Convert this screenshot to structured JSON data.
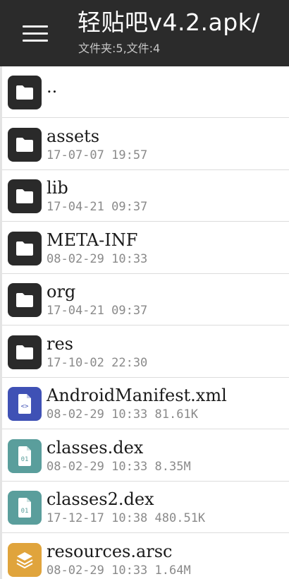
{
  "appbar": {
    "title": "轻贴吧v4.2.apk/",
    "subtitle": "文件夹:5,文件:4",
    "menu_icon": "hamburger-menu-icon",
    "color": "#2b2b2b"
  },
  "colors": {
    "folder": "#2a2a2a",
    "xml": "#3f51b5",
    "dex": "#5a9e9c",
    "arsc": "#e0a43c"
  },
  "files": [
    {
      "name": "..",
      "meta": "",
      "kind": "folder",
      "icon": "folder-icon"
    },
    {
      "name": "assets",
      "meta": "17-07-07 19:57",
      "kind": "folder",
      "icon": "folder-icon"
    },
    {
      "name": "lib",
      "meta": "17-04-21 09:37",
      "kind": "folder",
      "icon": "folder-icon"
    },
    {
      "name": "META-INF",
      "meta": "08-02-29 10:33",
      "kind": "folder",
      "icon": "folder-icon"
    },
    {
      "name": "org",
      "meta": "17-04-21 09:37",
      "kind": "folder",
      "icon": "folder-icon"
    },
    {
      "name": "res",
      "meta": "17-10-02 22:30",
      "kind": "folder",
      "icon": "folder-icon"
    },
    {
      "name": "AndroidManifest.xml",
      "meta": "08-02-29 10:33  81.61K",
      "kind": "xml",
      "icon": "code-file-icon"
    },
    {
      "name": "classes.dex",
      "meta": "08-02-29 10:33  8.35M",
      "kind": "dex",
      "icon": "binary-file-icon"
    },
    {
      "name": "classes2.dex",
      "meta": "17-12-17 10:38  480.51K",
      "kind": "dex",
      "icon": "binary-file-icon"
    },
    {
      "name": "resources.arsc",
      "meta": "08-02-29 10:33  1.64M",
      "kind": "arsc",
      "icon": "layers-icon"
    }
  ]
}
